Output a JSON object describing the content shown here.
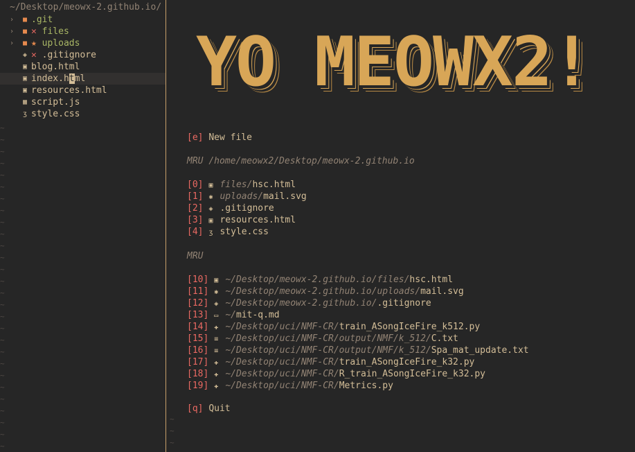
{
  "tree": {
    "title": "~/Desktop/meowx-2.github.io/",
    "items": [
      {
        "chevron": "›",
        "icon": "■",
        "mark": "",
        "name": ".git",
        "type": "folder-git"
      },
      {
        "chevron": "›",
        "icon": "■",
        "mark": "✕",
        "name": "files",
        "type": "folder"
      },
      {
        "chevron": "›",
        "icon": "■",
        "mark": "★",
        "name": "uploads",
        "type": "folder"
      },
      {
        "chevron": "",
        "icon": "◈",
        "mark": "✕",
        "name": ".gitignore",
        "type": "file"
      },
      {
        "chevron": "",
        "icon": "▣",
        "mark": "",
        "name": "blog.html",
        "type": "file"
      },
      {
        "chevron": "",
        "icon": "▣",
        "mark": "",
        "name_before": "index.h",
        "name_cursor": "t",
        "name_after": "ml",
        "type": "file-active"
      },
      {
        "chevron": "",
        "icon": "▣",
        "mark": "",
        "name": "resources.html",
        "type": "file"
      },
      {
        "chevron": "",
        "icon": "▦",
        "mark": "",
        "name": "script.js",
        "type": "file"
      },
      {
        "chevron": "",
        "icon": "ʒ",
        "mark": "",
        "name": "style.css",
        "type": "file"
      }
    ],
    "tilde": "~"
  },
  "banner": "YO MEOWX2!",
  "new_file": {
    "key": "[e]",
    "label": "New file"
  },
  "mru_local": {
    "header_prefix": "MRU",
    "header_path": "/home/meowx2/Desktop/meowx-2.github.io",
    "items": [
      {
        "key": "[0]",
        "icon": "▣",
        "dir": "files/",
        "name": "hsc.html"
      },
      {
        "key": "[1]",
        "icon": "✱",
        "dir": "uploads/",
        "name": "mail.svg"
      },
      {
        "key": "[2]",
        "icon": "◈",
        "dir": "",
        "name": ".gitignore"
      },
      {
        "key": "[3]",
        "icon": "▣",
        "dir": "",
        "name": "resources.html"
      },
      {
        "key": "[4]",
        "icon": "ʒ",
        "dir": "",
        "name": "style.css"
      }
    ]
  },
  "mru_global": {
    "header": "MRU",
    "items": [
      {
        "key": "[10]",
        "icon": "▣",
        "dir": "~/Desktop/meowx-2.github.io/files/",
        "name": "hsc.html"
      },
      {
        "key": "[11]",
        "icon": "✱",
        "dir": "~/Desktop/meowx-2.github.io/uploads/",
        "name": "mail.svg"
      },
      {
        "key": "[12]",
        "icon": "◈",
        "dir": "~/Desktop/meowx-2.github.io/",
        "name": ".gitignore"
      },
      {
        "key": "[13]",
        "icon": "▭",
        "dir": "~/",
        "name": "mit-q.md"
      },
      {
        "key": "[14]",
        "icon": "✚",
        "dir": "~/Desktop/uci/NMF-CR/",
        "name": "train_ASongIceFire_k512.py"
      },
      {
        "key": "[15]",
        "icon": "≡",
        "dir": "~/Desktop/uci/NMF-CR/output/NMF/k_512/",
        "name": "C.txt"
      },
      {
        "key": "[16]",
        "icon": "≡",
        "dir": "~/Desktop/uci/NMF-CR/output/NMF/k_512/",
        "name": "Spa_mat_update.txt"
      },
      {
        "key": "[17]",
        "icon": "✚",
        "dir": "~/Desktop/uci/NMF-CR/",
        "name": "train_ASongIceFire_k32.py"
      },
      {
        "key": "[18]",
        "icon": "✚",
        "dir": "~/Desktop/uci/NMF-CR/",
        "name": "R_train_ASongIceFire_k32.py"
      },
      {
        "key": "[19]",
        "icon": "✚",
        "dir": "~/Desktop/uci/NMF-CR/",
        "name": "Metrics.py"
      }
    ]
  },
  "quit": {
    "key": "[q]",
    "label": "Quit"
  }
}
